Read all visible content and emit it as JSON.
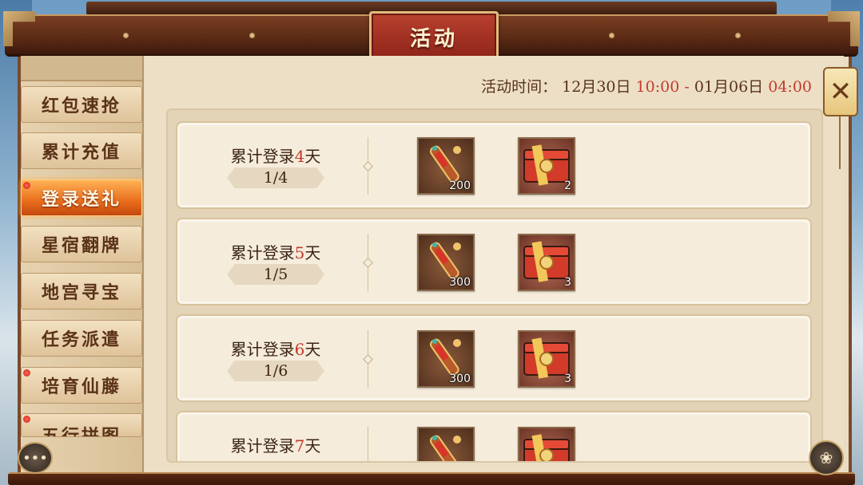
{
  "window": {
    "title": "活动"
  },
  "colors": {
    "accent_red": "#c43a2a",
    "tab_active": "#e86d1c"
  },
  "sidebar": {
    "items": [
      {
        "label": "红包速抢",
        "dot": false,
        "active": false
      },
      {
        "label": "累计充值",
        "dot": false,
        "active": false
      },
      {
        "label": "登录送礼",
        "dot": true,
        "active": true
      },
      {
        "label": "星宿翻牌",
        "dot": false,
        "active": false
      },
      {
        "label": "地宫寻宝",
        "dot": false,
        "active": false
      },
      {
        "label": "任务派遣",
        "dot": false,
        "active": false
      },
      {
        "label": "培育仙藤",
        "dot": true,
        "active": false
      },
      {
        "label": "五行拼图",
        "dot": true,
        "active": false
      }
    ]
  },
  "event_time": {
    "label": "活动时间：",
    "start_date": "12月30日",
    "start_time": "10:00",
    "separator": " - ",
    "end_date": "01月06日",
    "end_time": "04:00"
  },
  "rewards": [
    {
      "prefix": "累计登录",
      "days": "4",
      "suffix": "天",
      "progress": "1/4",
      "items": [
        {
          "icon": "scroll-icon",
          "qty": "200"
        },
        {
          "icon": "red-chest-icon",
          "qty": "2"
        }
      ]
    },
    {
      "prefix": "累计登录",
      "days": "5",
      "suffix": "天",
      "progress": "1/5",
      "items": [
        {
          "icon": "scroll-icon",
          "qty": "300"
        },
        {
          "icon": "red-chest-icon",
          "qty": "3"
        }
      ]
    },
    {
      "prefix": "累计登录",
      "days": "6",
      "suffix": "天",
      "progress": "1/6",
      "items": [
        {
          "icon": "scroll-icon",
          "qty": "300"
        },
        {
          "icon": "red-chest-icon",
          "qty": "3"
        }
      ]
    },
    {
      "prefix": "累计登录",
      "days": "7",
      "suffix": "天",
      "progress": "",
      "items": [
        {
          "icon": "scroll-icon",
          "qty": ""
        },
        {
          "icon": "red-chest-icon",
          "qty": ""
        }
      ]
    }
  ],
  "icons": {
    "close": "close-icon",
    "chat": "chat-icon",
    "util": "gourd-icon"
  }
}
